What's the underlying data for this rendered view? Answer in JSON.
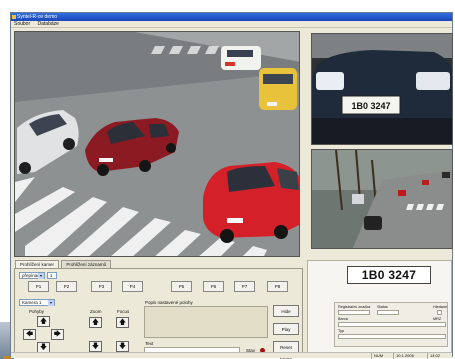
{
  "window": {
    "title": "Syntel-R-ov demo"
  },
  "menu": {
    "items": [
      "Soubor",
      "Databáze"
    ]
  },
  "tabs": [
    {
      "label": "Prohlížení kamer",
      "active": true
    },
    {
      "label": "Prohlížení záznamů",
      "active": false
    }
  ],
  "controls": {
    "camera_group_select": "přepínač 1",
    "camera_group_value": "1",
    "camera_select": "Kamera 1",
    "presets": [
      "P1",
      "P2",
      "P3",
      "P4",
      "P5",
      "P6",
      "P7",
      "P8"
    ],
    "pan_label": "Pohyby",
    "zoom_label": "Zoom",
    "focus_label": "Focus",
    "notes_label": "Popis nastavené polohy",
    "text_label": "Text",
    "status_label": "Stav",
    "buttons": {
      "hide": "Hide",
      "play": "Play",
      "reset": "Reset kamer"
    }
  },
  "plate_panel": {
    "plate_number": "1B0 3247",
    "fields": {
      "registration": "Registrační značka",
      "status": "Status",
      "wanted": "Hledané",
      "color": "Barva",
      "mrz": "MRZ",
      "type": "Typ"
    }
  },
  "statusbar": {
    "left": "",
    "num": "NUM",
    "date": "10.1.2006",
    "time": "14:02"
  },
  "colors": {
    "titlebar": "#1945b9",
    "window_bg": "#ece9d8",
    "red_car": "#c8202a",
    "status_led": "#a01010"
  }
}
